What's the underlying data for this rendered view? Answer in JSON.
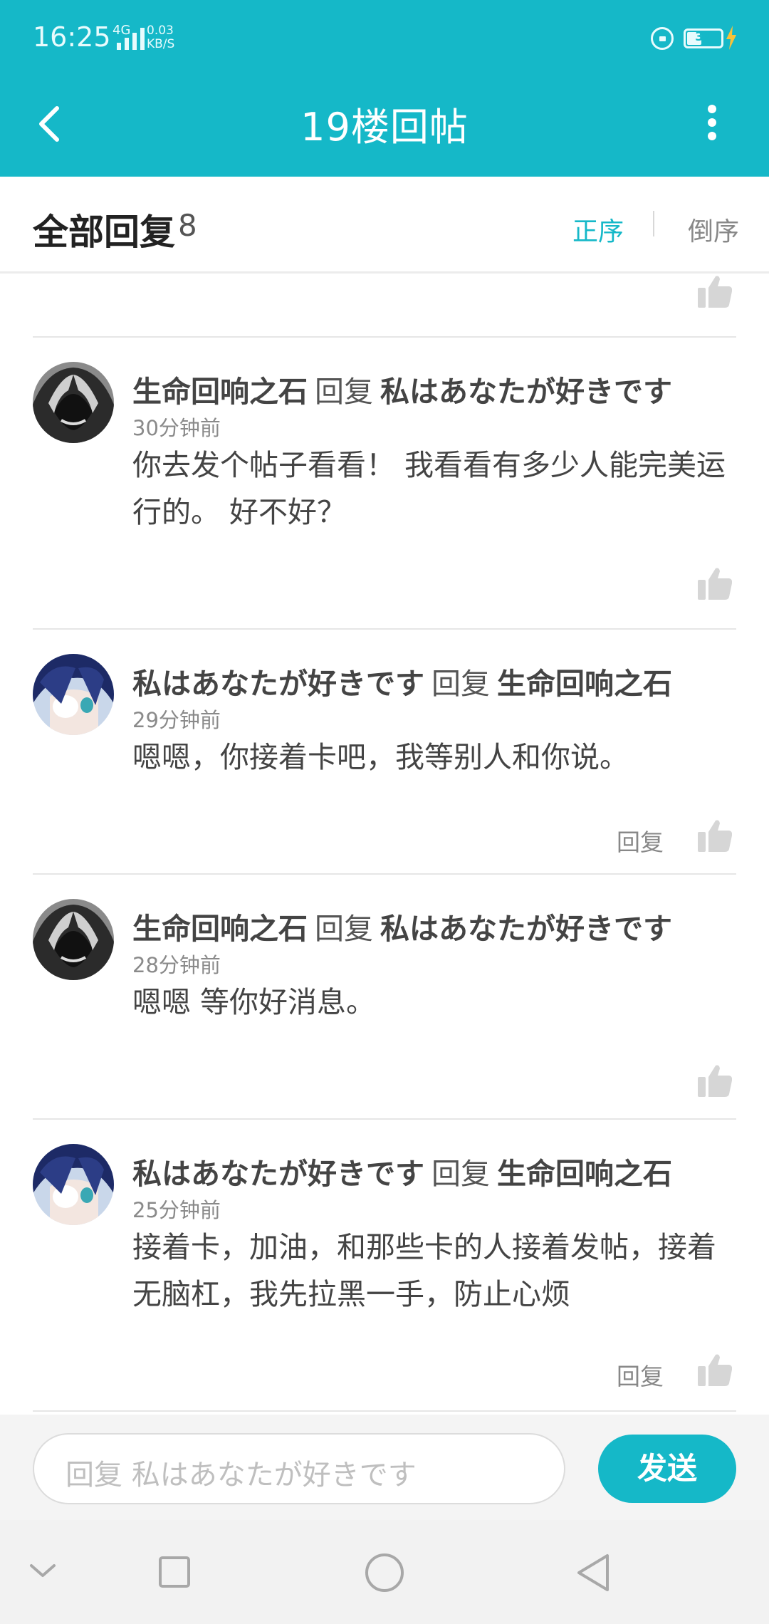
{
  "status_bar": {
    "time": "16:25",
    "network": "4G",
    "speed_value": "0.03",
    "speed_unit": "KB/S",
    "battery": "39"
  },
  "app_bar": {
    "title": "19楼回帖"
  },
  "section": {
    "label": "全部回复",
    "count": "8",
    "sort_asc": "正序",
    "sort_desc": "倒序"
  },
  "comments": [
    {
      "author": "生命回响之石",
      "verb": "回复",
      "target": "私はあなたが好きです",
      "time": "30分钟前",
      "body": "你去发个帖子看看！  我看看有多少人能完美运行的。 好不好？",
      "reply_label": ""
    },
    {
      "author": "私はあなたが好きです",
      "verb": "回复",
      "target": "生命回响之石",
      "time": "29分钟前",
      "body": "嗯嗯，你接着卡吧，我等别人和你说。",
      "reply_label": "回复"
    },
    {
      "author": "生命回响之石",
      "verb": "回复",
      "target": "私はあなたが好きです",
      "time": "28分钟前",
      "body": "嗯嗯  等你好消息。",
      "reply_label": ""
    },
    {
      "author": "私はあなたが好きです",
      "verb": "回复",
      "target": "生命回响之石",
      "time": "25分钟前",
      "body": "接着卡，加油，和那些卡的人接着发帖，接着无脑杠，我先拉黑一手，防止心烦",
      "reply_label": "回复"
    }
  ],
  "input_bar": {
    "placeholder": "回复 私はあなたが好きです",
    "send_label": "发送"
  },
  "colors": {
    "accent": "#15b8c8",
    "divider": "#e6e6e6"
  },
  "icons": {
    "back": "back-arrow-icon",
    "more": "more-vertical-icon",
    "like": "thumbs-up-icon",
    "nav": [
      "chevron-down-icon",
      "square-icon",
      "circle-icon",
      "triangle-back-icon"
    ]
  }
}
